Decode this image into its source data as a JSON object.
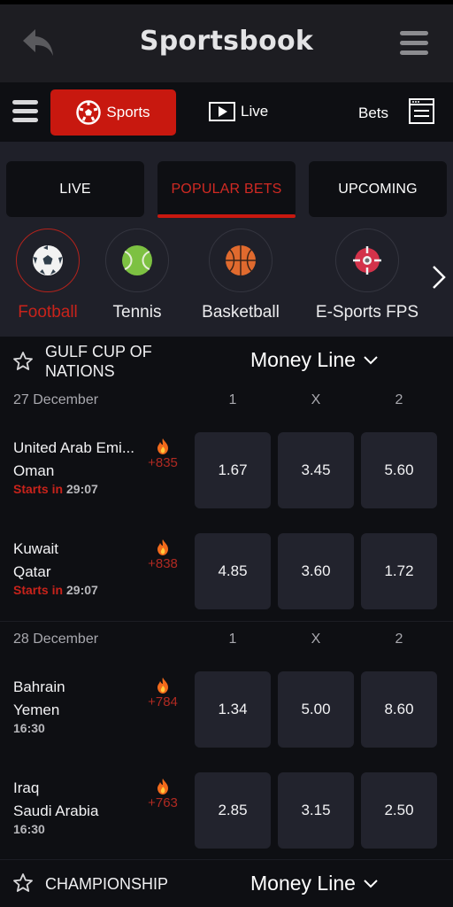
{
  "app": {
    "title": "Sportsbook"
  },
  "nav": {
    "sports_label": "Sports",
    "live_label": "Live",
    "bets_label": "Bets"
  },
  "tabs": [
    {
      "label": "LIVE",
      "active": false
    },
    {
      "label": "POPULAR BETS",
      "active": true
    },
    {
      "label": "UPCOMING",
      "active": false
    }
  ],
  "sports": [
    {
      "label": "Football",
      "icon": "soccer-ball-icon",
      "active": true
    },
    {
      "label": "Tennis",
      "icon": "tennis-ball-icon",
      "active": false
    },
    {
      "label": "Basketball",
      "icon": "basketball-icon",
      "active": false
    },
    {
      "label": "E-Sports FPS",
      "icon": "crosshair-icon",
      "active": false
    }
  ],
  "leagues": [
    {
      "name": "GULF CUP OF NATIONS",
      "market": "Money Line",
      "days": [
        {
          "date": "27 December",
          "columns": [
            "1",
            "X",
            "2"
          ],
          "matches": [
            {
              "home": "United Arab Emi...",
              "away": "Oman",
              "status_prefix": "Starts in",
              "time": "29:07",
              "count": "+835",
              "odds": [
                "1.67",
                "3.45",
                "5.60"
              ]
            },
            {
              "home": "Kuwait",
              "away": "Qatar",
              "status_prefix": "Starts in",
              "time": "29:07",
              "count": "+838",
              "odds": [
                "4.85",
                "3.60",
                "1.72"
              ]
            }
          ]
        },
        {
          "date": "28 December",
          "columns": [
            "1",
            "X",
            "2"
          ],
          "matches": [
            {
              "home": "Bahrain",
              "away": "Yemen",
              "status_prefix": "",
              "time": "16:30",
              "count": "+784",
              "odds": [
                "1.34",
                "5.00",
                "8.60"
              ]
            },
            {
              "home": "Iraq",
              "away": "Saudi Arabia",
              "status_prefix": "",
              "time": "16:30",
              "count": "+763",
              "odds": [
                "2.85",
                "3.15",
                "2.50"
              ]
            }
          ]
        }
      ]
    },
    {
      "name": "CHAMPIONSHIP",
      "market": "Money Line"
    }
  ],
  "colors": {
    "accent": "#c8180f",
    "background": "#0e0f13",
    "odds_button": "#22232d",
    "panel": "#1f2029"
  }
}
